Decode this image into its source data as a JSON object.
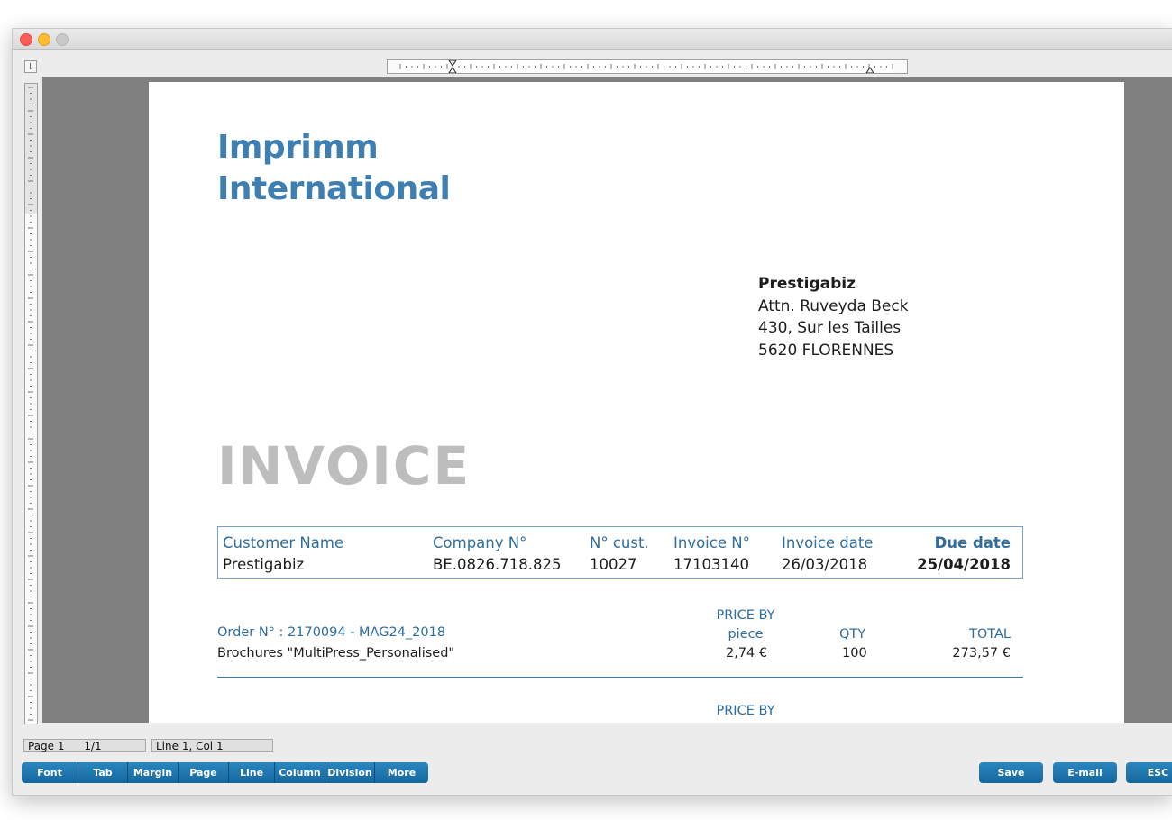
{
  "document": {
    "company_line1": "Imprimm",
    "company_line2": "International",
    "address": {
      "name": "Prestigabiz",
      "attn": "Attn. Ruveyda Beck",
      "street": "430, Sur les Tailles",
      "city": "5620 FLORENNES"
    },
    "title": "INVOICE",
    "info": {
      "customer_name_label": "Customer Name",
      "customer_name_value": "Prestigabiz",
      "company_no_label": "Company N°",
      "company_no_value": "BE.0826.718.825",
      "cust_no_label": "N° cust.",
      "cust_no_value": "10027",
      "invoice_no_label": "Invoice N°",
      "invoice_no_value": "17103140",
      "invoice_date_label": "Invoice date",
      "invoice_date_value": "26/03/2018",
      "due_date_label": "Due date",
      "due_date_value": "25/04/2018"
    },
    "order1": {
      "label": "Order N° : 2170094 - MAG24_2018",
      "description": "Brochures \"MultiPress_Personalised\"",
      "price_header_1": "PRICE BY",
      "price_header_2": "piece",
      "qty_header": "QTY",
      "total_header": "TOTAL",
      "price": "2,74 €",
      "qty": "100",
      "total": "273,57 €"
    },
    "order2": {
      "price_header_1": "PRICE BY"
    }
  },
  "status": {
    "page": "Page 1",
    "page_count": "1/1",
    "cursor": "Line 1, Col 1"
  },
  "toolbar": {
    "font": "Font",
    "tab": "Tab",
    "margin": "Margin",
    "page": "Page",
    "line": "Line",
    "column": "Column",
    "division": "Division",
    "more": "More"
  },
  "actions": {
    "save": "Save",
    "email": "E-mail",
    "esc": "ESC"
  },
  "colors": {
    "accent_blue": "#3e7eb0",
    "button_blue": "#1f77b0",
    "invoice_gray": "#bdbdbd"
  }
}
